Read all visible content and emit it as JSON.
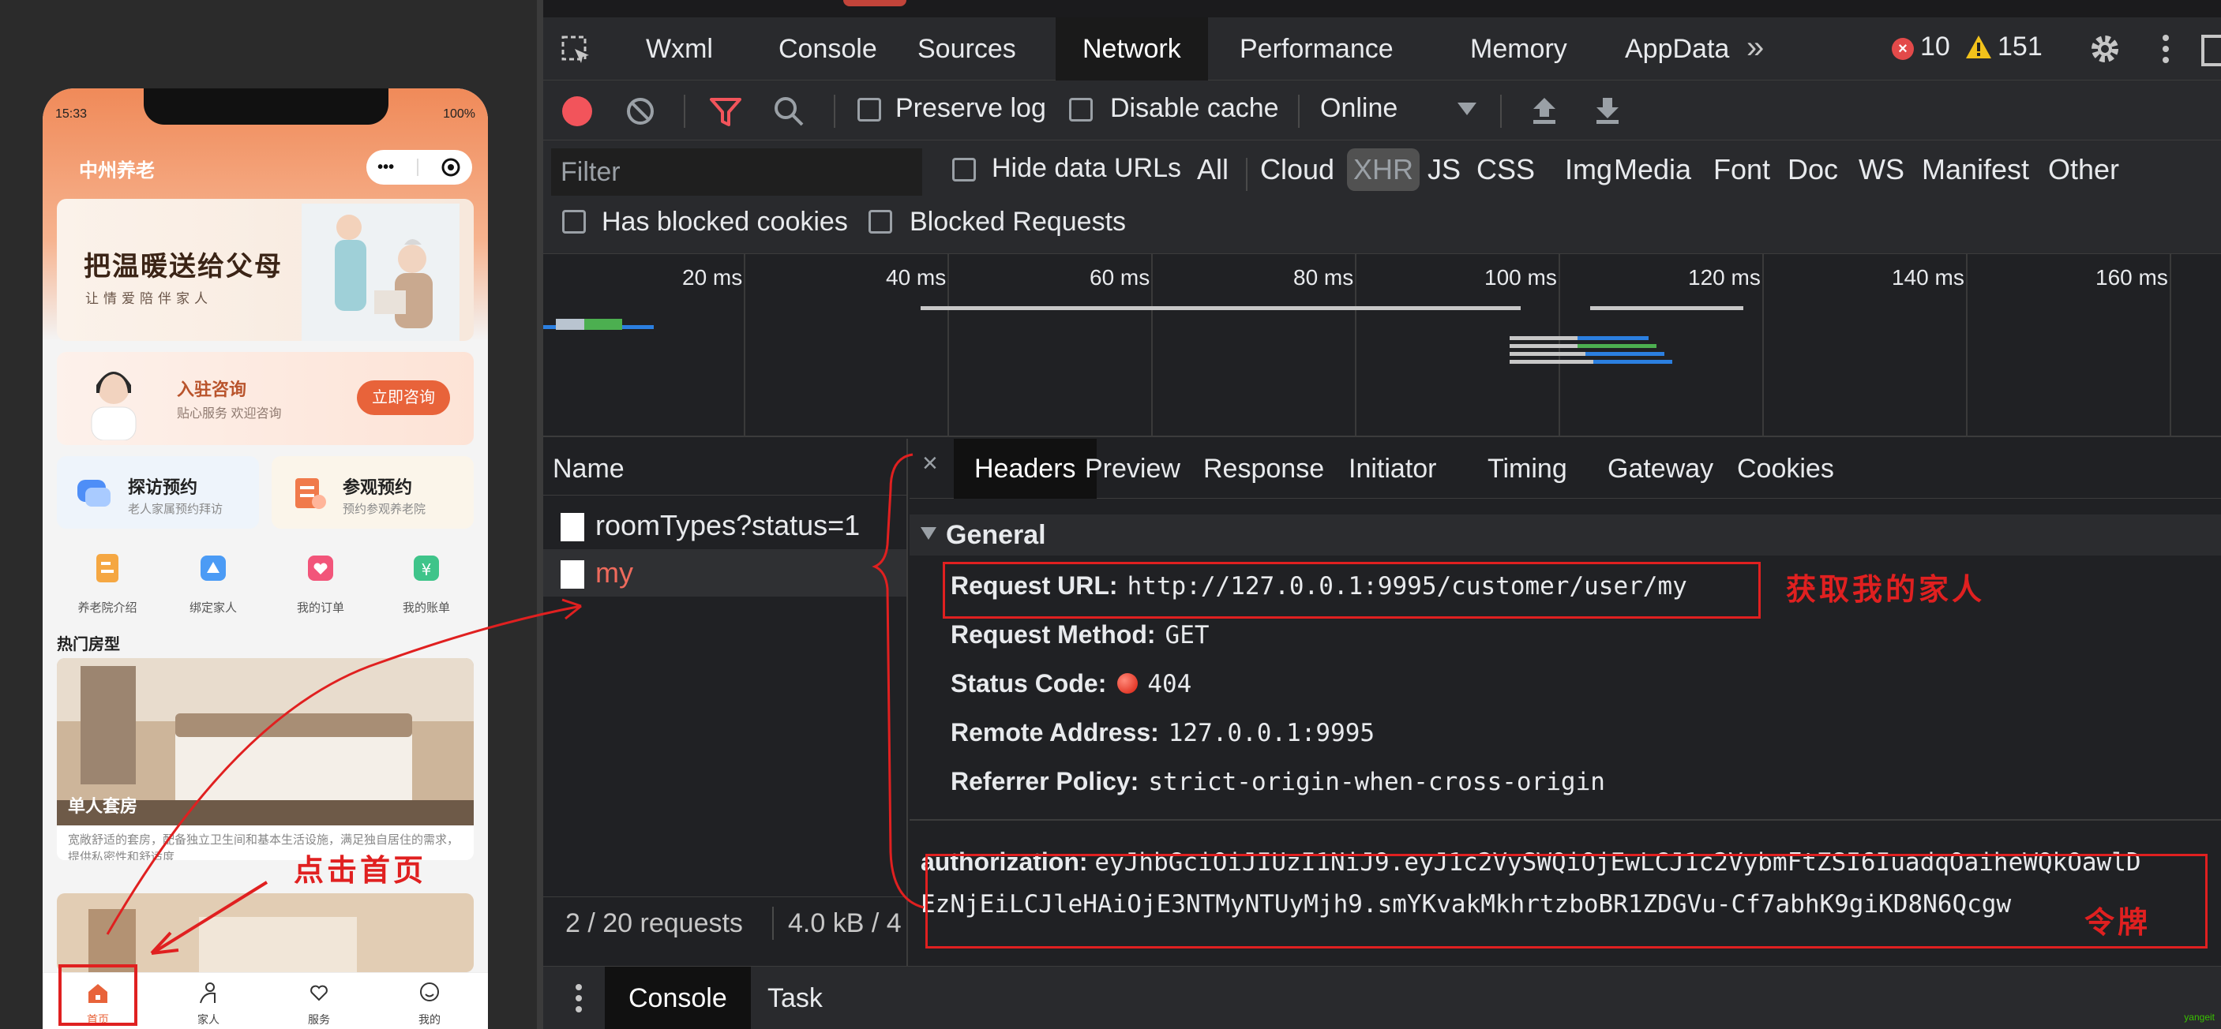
{
  "phone": {
    "status_time": "15:33",
    "status_battery": "100%",
    "app_title": "中州养老",
    "capsule_more": "•••",
    "banner_title": "把温暖送给父母",
    "banner_sub": "让情爱陪伴家人",
    "consult_title": "入驻咨询",
    "consult_sub": "贴心服务 欢迎咨询",
    "consult_btn": "立即咨询",
    "visit_cards": [
      {
        "title": "探访预约",
        "sub": "老人家属预约拜访"
      },
      {
        "title": "参观预约",
        "sub": "预约参观养老院"
      }
    ],
    "grid": [
      "养老院介绍",
      "绑定家人",
      "我的订单",
      "我的账单"
    ],
    "hot_title": "热门房型",
    "room_name": "单人套房",
    "room_desc": "宽敞舒适的套房，配备独立卫生间和基本生活设施，满足独自居住的需求，提供私密性和舒适度",
    "tabs": [
      "首页",
      "家人",
      "服务",
      "我的"
    ]
  },
  "devtools": {
    "tabs": [
      "Wxml",
      "Console",
      "Sources",
      "Network",
      "Performance",
      "Memory",
      "AppData"
    ],
    "active_tab": "Network",
    "more_tabs": "»",
    "error_count": "10",
    "warning_count": "151",
    "toolbar": {
      "preserve_log": "Preserve log",
      "disable_cache": "Disable cache",
      "throttle": "Online"
    },
    "filter": {
      "placeholder": "Filter",
      "hide_data_urls": "Hide data URLs",
      "types": [
        "All",
        "Cloud",
        "XHR",
        "JS",
        "CSS",
        "Img",
        "Media",
        "Font",
        "Doc",
        "WS",
        "Manifest",
        "Other"
      ],
      "has_blocked_cookies": "Has blocked cookies",
      "blocked_requests": "Blocked Requests"
    },
    "timeline_ticks": [
      "20 ms",
      "40 ms",
      "60 ms",
      "80 ms",
      "100 ms",
      "120 ms",
      "140 ms",
      "160 ms"
    ],
    "requests": {
      "header": "Name",
      "rows": [
        "roomTypes?status=1",
        "my"
      ],
      "summary_count": "2 / 20 requests",
      "summary_size": "4.0 kB / 4"
    },
    "detail_tabs": [
      "Headers",
      "Preview",
      "Response",
      "Initiator",
      "Timing",
      "Gateway",
      "Cookies"
    ],
    "close_label": "×",
    "general": {
      "title": "General",
      "request_url_key": "Request URL:",
      "request_url": "http://127.0.0.1:9995/customer/user/my",
      "method_key": "Request Method:",
      "method": "GET",
      "status_key": "Status Code:",
      "status": "404",
      "remote_key": "Remote Address:",
      "remote": "127.0.0.1:9995",
      "referrer_key": "Referrer Policy:",
      "referrer": "strict-origin-when-cross-origin"
    },
    "auth": {
      "key": "authorization:",
      "value_line1": "eyJhbGciOiJIUzI1NiJ9.eyJ1c2VySWQiOjEwLCJ1c2VybmFtZSI6IuadqOaiheWQkOawlD",
      "value_line2": "EzNjEiLCJleHAiOjE3NTMyNTUyMjh9.smYKvakMkhrtzboBR1ZDGVu-Cf7abhK9giKD8N6Qcgw"
    },
    "drawer_tabs": [
      "Console",
      "Task"
    ],
    "watermark": "yangeit"
  },
  "annotations": {
    "url_note": "获取我的家人",
    "token_note": "令牌",
    "click_note": "点击首页"
  },
  "colors": {
    "accent": "#e8633a",
    "annotation_red": "#e02020",
    "devtools_bg": "#202124"
  }
}
